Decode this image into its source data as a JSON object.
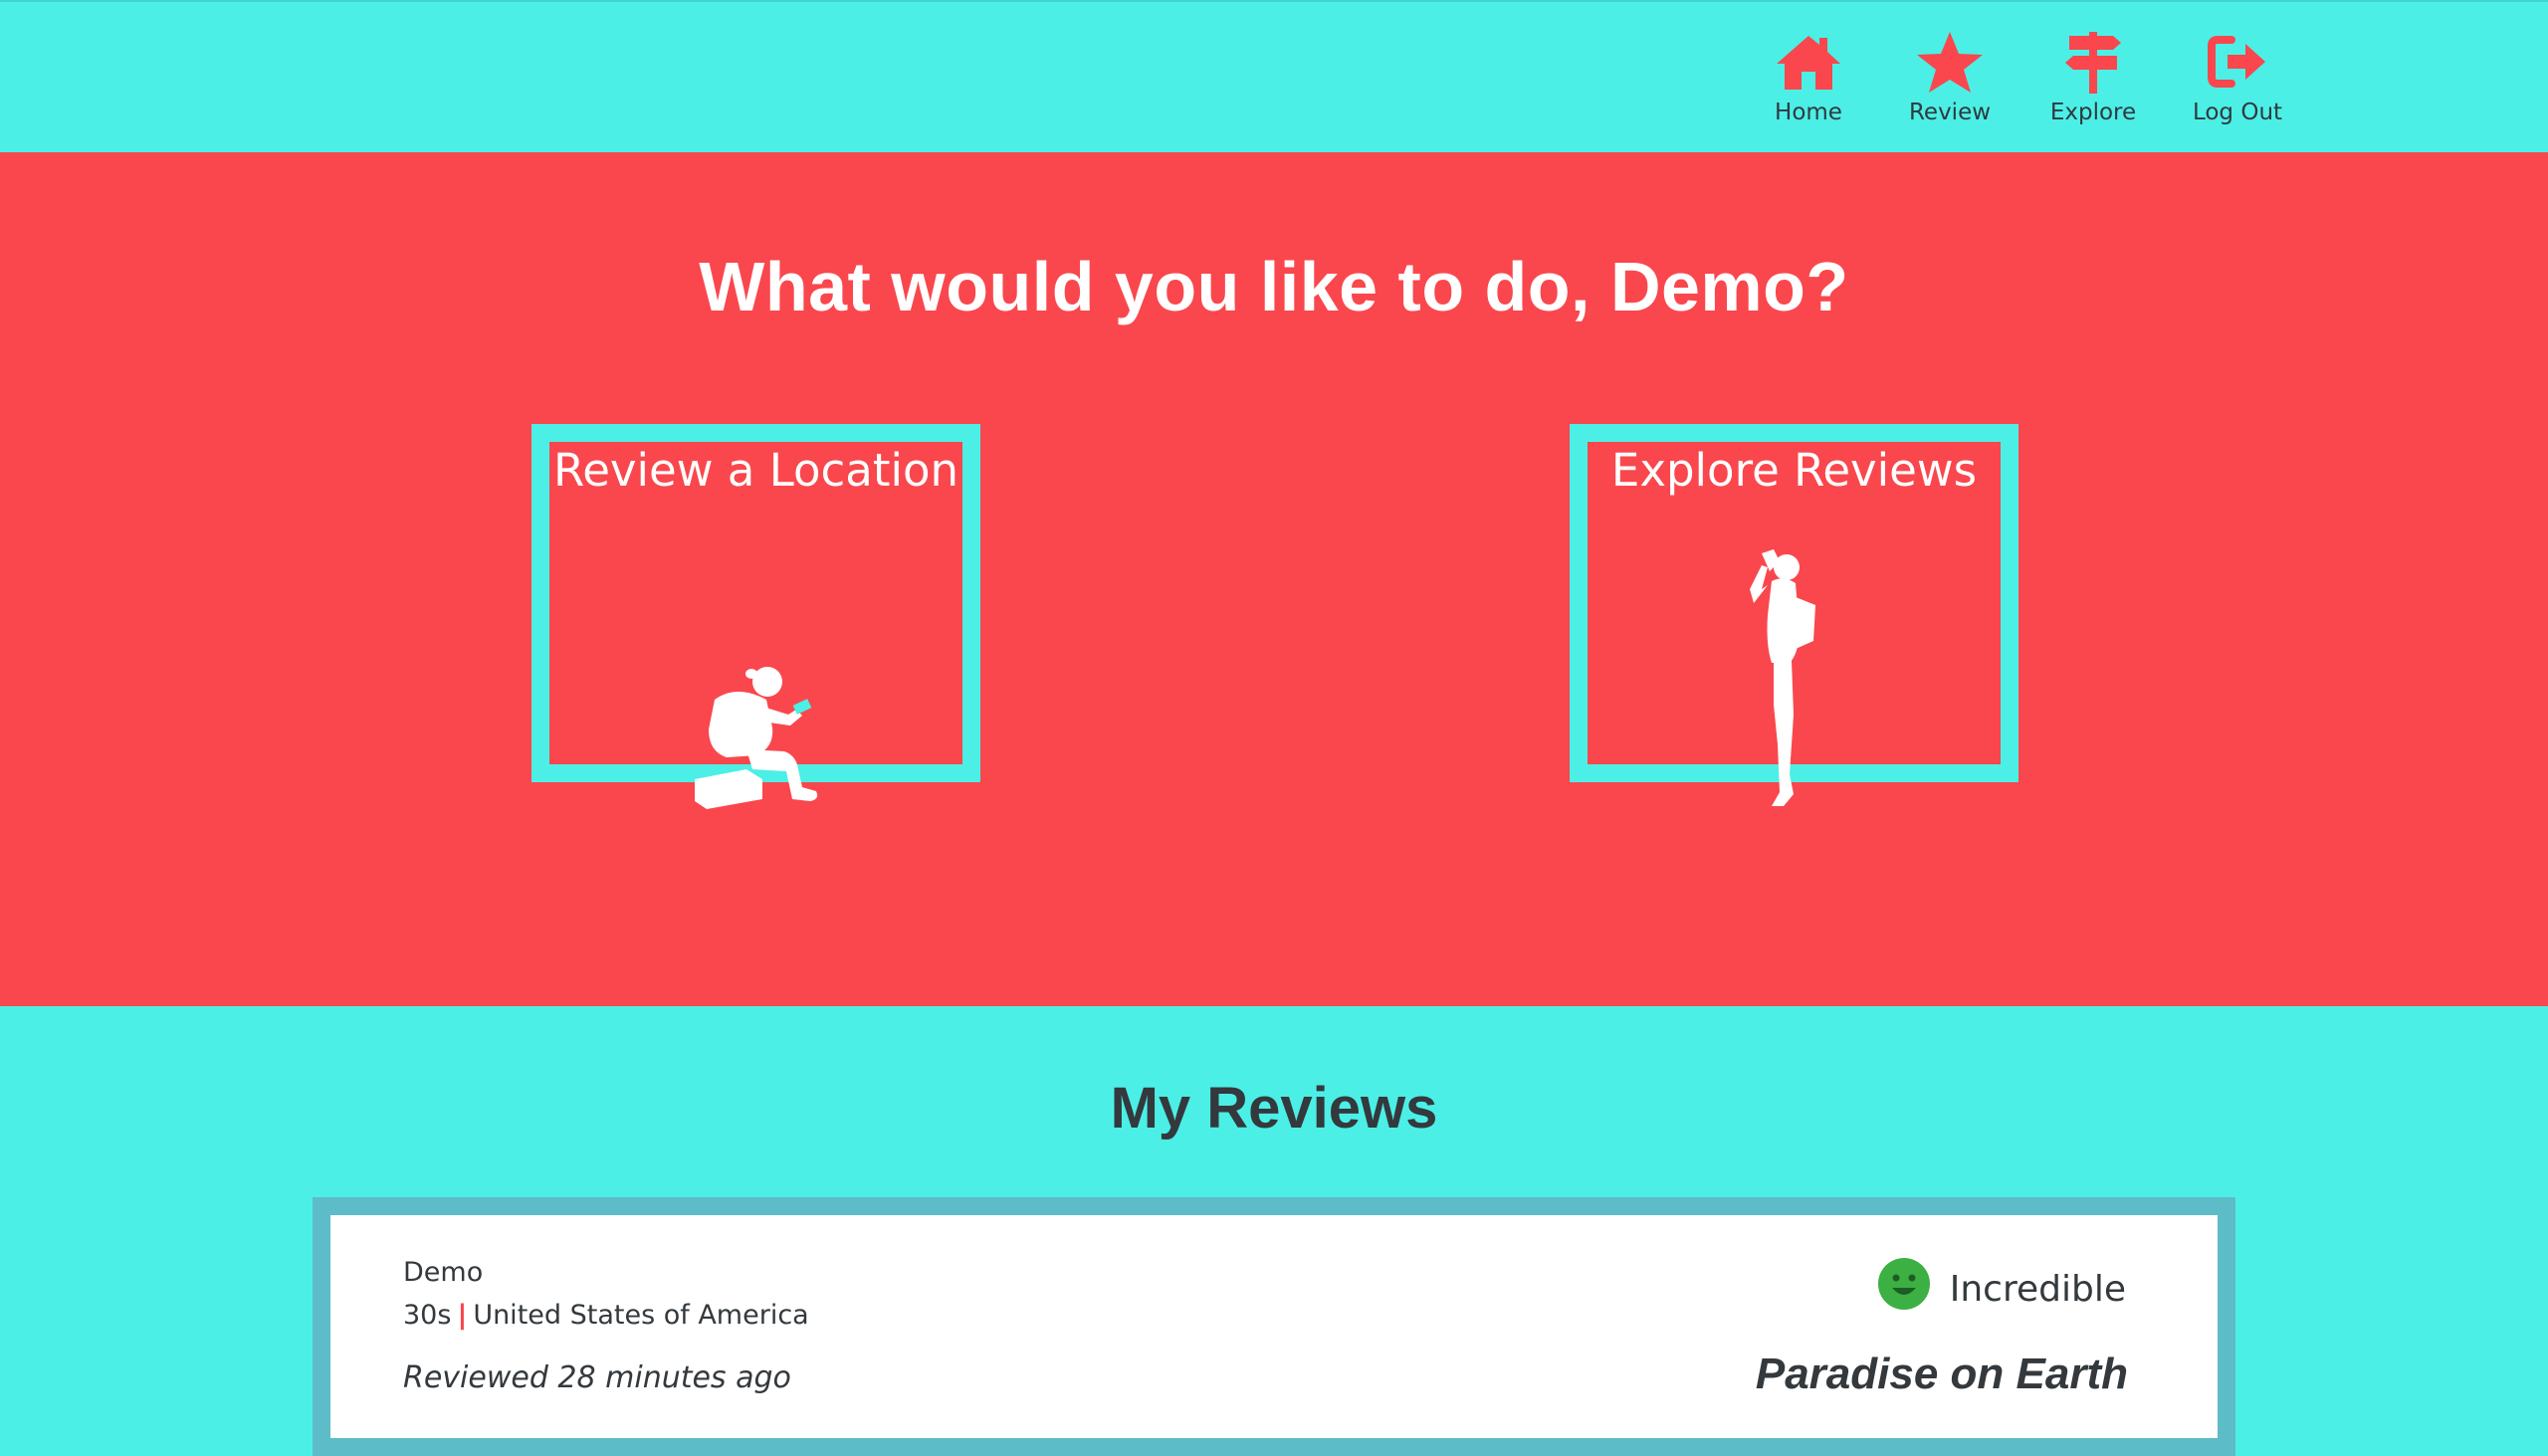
{
  "nav": {
    "items": [
      {
        "label": "Home",
        "icon": "home-icon"
      },
      {
        "label": "Review",
        "icon": "star-icon"
      },
      {
        "label": "Explore",
        "icon": "signpost-icon"
      },
      {
        "label": "Log Out",
        "icon": "logout-icon"
      }
    ]
  },
  "hero": {
    "title": "What would you like to do, Demo?",
    "actions": [
      {
        "label": "Review a Location",
        "icon": "sitting-traveler-illustration"
      },
      {
        "label": "Explore Reviews",
        "icon": "standing-photographer-illustration"
      }
    ]
  },
  "reviews": {
    "title": "My Reviews",
    "items": [
      {
        "author": "Demo",
        "age": "30s",
        "country": "United States of America",
        "time": "Reviewed 28 minutes ago",
        "rating": "Incredible",
        "rating_icon": "smiley-face-icon",
        "headline": "Paradise on Earth"
      }
    ]
  },
  "colors": {
    "teal": "#4cefe6",
    "coral": "#f9474d",
    "dark_text": "#33393d",
    "card_border": "#5cbcc8",
    "rating_green": "#3cb043"
  }
}
